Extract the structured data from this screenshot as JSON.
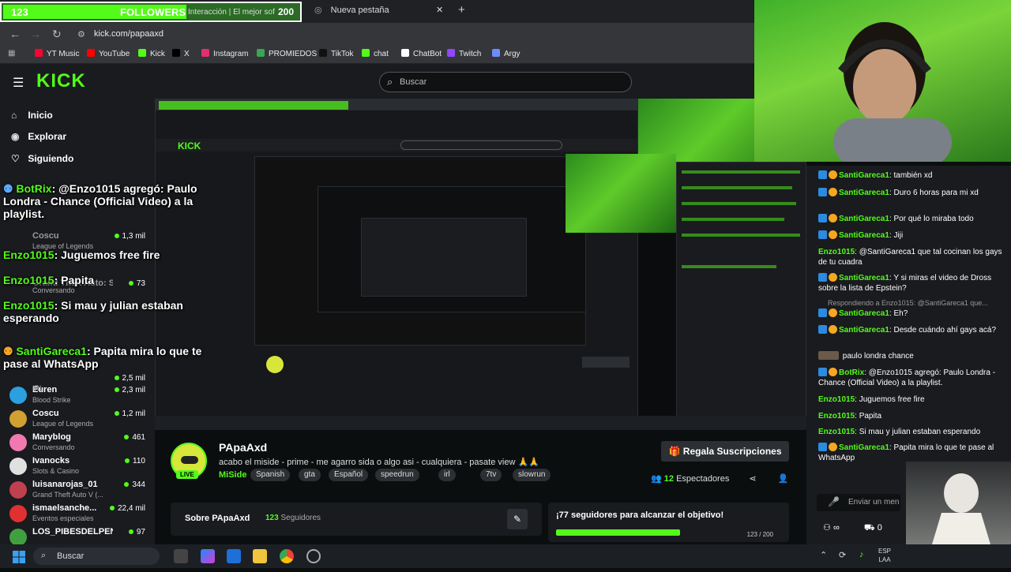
{
  "browser": {
    "tab1": {
      "followers_count": "123",
      "followers_label": "FOLLOWERS",
      "title": "Interacción | El mejor softwa",
      "goal": "200",
      "progress": 0.615
    },
    "tab2": {
      "title": "Nueva pestaña",
      "close": "✕"
    },
    "new_tab": "+",
    "url": "kick.com/papaaxd",
    "bookmarks": [
      "YT Music",
      "YouTube",
      "Kick",
      "X",
      "Instagram",
      "PROMIEDOS",
      "TikTok",
      "chat",
      "ChatBot",
      "Twitch",
      "Argy"
    ],
    "bookmark_colors": [
      "#ff0033",
      "#ff0000",
      "#53fc18",
      "#000000",
      "#e1306c",
      "#3aa655",
      "#111111",
      "#53fc18",
      "#ffffff",
      "#9146ff",
      "#6d8cff"
    ]
  },
  "kick": {
    "logo": "KICK",
    "search_placeholder": "Buscar",
    "nav": [
      {
        "label": "Inicio",
        "icon": "home-icon"
      },
      {
        "label": "Explorar",
        "icon": "compass-icon"
      },
      {
        "label": "Siguiendo",
        "icon": "heart-icon"
      }
    ],
    "sidebar_channels": [
      {
        "name": "Coscu",
        "game": "League of Legends",
        "viewers": "1,3 mil"
      },
      {
        "name": "Grand Theft Auto: San...",
        "game": "",
        "viewers": "73"
      },
      {
        "name": "Conversando",
        "game": "",
        "viewers": ""
      },
      {
        "name": "",
        "game": "IRL",
        "viewers": "2,5 mil"
      },
      {
        "name": "Euren",
        "game": "Blood Strike",
        "viewers": "2,3 mil"
      },
      {
        "name": "Coscu",
        "game": "League of Legends",
        "viewers": "1,2 mil"
      },
      {
        "name": "Maryblog",
        "game": "Conversando",
        "viewers": "461"
      },
      {
        "name": "Ivanocks",
        "game": "Slots & Casino",
        "viewers": "110"
      },
      {
        "name": "luisanarojas_01",
        "game": "Grand Theft Auto V (...",
        "viewers": "344"
      },
      {
        "name": "ismaelsanche...",
        "game": "Eventos especiales",
        "viewers": "22,4 mil"
      },
      {
        "name": "LOS_PIBESDELPEN...",
        "game": "",
        "viewers": "97"
      }
    ]
  },
  "overlay_chat": [
    {
      "user": "BotRix",
      "text": ": @Enzo1015 agregó: Paulo Londra - Chance (Official Video) a la playlist."
    },
    {
      "user": "Enzo1015",
      "text": ": Juguemos free fire"
    },
    {
      "user": "Enzo1015",
      "text": ": Papita"
    },
    {
      "user": "Enzo1015",
      "text": ": Si mau y julian estaban esperando"
    },
    {
      "user": "SantiGareca1",
      "text": ": Papita mira lo que te pase al WhatsApp"
    }
  ],
  "stream": {
    "streamer": "PApaAxd",
    "live": "LIVE",
    "title": "acabo el miside - prime - me agarro sida o algo asi  - cualquiera - pasate view 🙏🙏",
    "category": "MiSide",
    "tags": [
      "Spanish",
      "gta",
      "Español",
      "speedrun",
      "irl",
      "7tv",
      "slowrun"
    ],
    "subscribe": "Regala Suscripciones",
    "viewers_count": "12",
    "viewers_label": "Espectadores",
    "about_title": "Sobre PApaAxd",
    "followers_count": "123",
    "followers_label": "Seguidores",
    "goal_text": "¡77 seguidores para alcanzar el objetivo!",
    "goal_count": "123 / 200",
    "goal_progress": 0.615
  },
  "chat": {
    "messages": [
      {
        "user": "SantiGareca1",
        "text": "también xd"
      },
      {
        "user": "SantiGareca1",
        "text": "Duro 6 horas para mi xd"
      },
      {
        "user": "SantiGareca1",
        "text": "Por qué lo miraba todo"
      },
      {
        "user": "SantiGareca1",
        "text": "Jiji"
      },
      {
        "user": "Enzo1015",
        "text": "@SantiGareca1 que tal cocinan los gays de tu cuadra"
      },
      {
        "user": "SantiGareca1",
        "text": "Y si miras el video de Dross sobre la lista de Epstein?"
      },
      {
        "user": "SantiGareca1",
        "text": "Eh?"
      },
      {
        "user": "SantiGareca1",
        "text": "Desde cuándo ahí gays acá?"
      },
      {
        "user": "",
        "text": "paulo londra chance"
      },
      {
        "user": "BotRix",
        "text": "@Enzo1015 agregó: Paulo Londra - Chance (Official Video) a la playlist."
      },
      {
        "user": "Enzo1015",
        "text": "Juguemos free fire"
      },
      {
        "user": "Enzo1015",
        "text": "Papita"
      },
      {
        "user": "Enzo1015",
        "text": "Si mau y julian estaban esperando"
      },
      {
        "user": "SantiGareca1",
        "text": "Papita mira lo que te pase al WhatsApp"
      }
    ],
    "reply_label": "Respondiendo a Enzo1015: @SantiGareca1 que...",
    "input_placeholder": "Enviar un men",
    "infinity_label": "∞",
    "count_label": "0"
  },
  "taskbar": {
    "search_placeholder": "Buscar",
    "lang_top": "ESP",
    "lang_bottom": "LAA"
  }
}
